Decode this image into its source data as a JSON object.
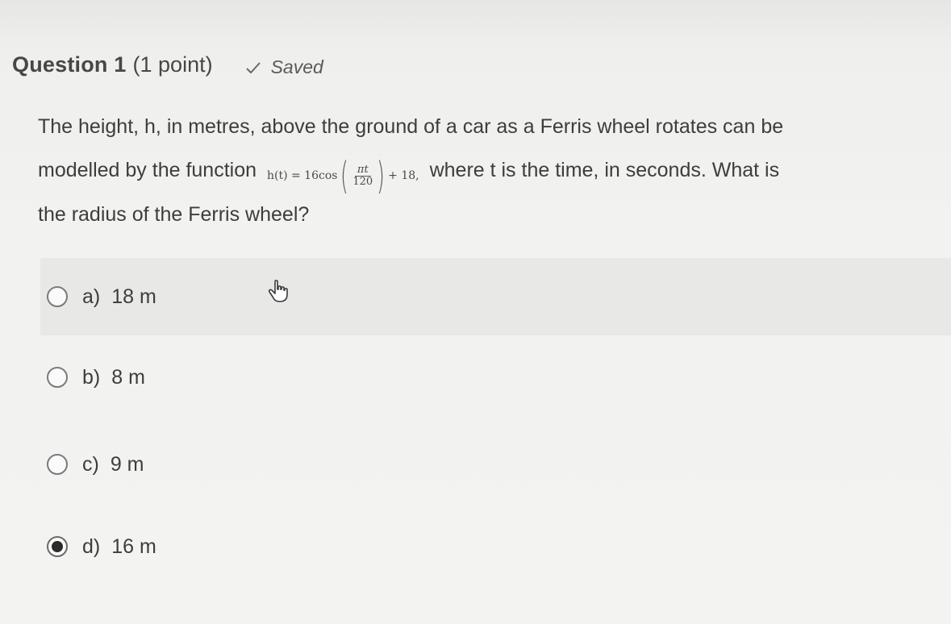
{
  "question": {
    "title": "Question 1",
    "points": "(1 point)",
    "status_icon": "check-icon",
    "status": "Saved",
    "text_line1": "The height, h, in metres, above the ground of a car as a Ferris wheel rotates can be",
    "text_line2_pre": "modelled by the function",
    "formula_lhs": "h(t) = 16cos",
    "formula_num": "πt",
    "formula_den": "120",
    "formula_rhs": "+ 18,",
    "text_line2_post": "where t is the time, in seconds. What is",
    "text_line3": "the radius of the Ferris wheel?"
  },
  "options": [
    {
      "letter": "a)",
      "value": "18 m",
      "selected": false
    },
    {
      "letter": "b)",
      "value": "8 m",
      "selected": false
    },
    {
      "letter": "c)",
      "value": "9 m",
      "selected": false
    },
    {
      "letter": "d)",
      "value": "16 m",
      "selected": true
    }
  ],
  "cursor_icon": "hand-pointer-icon"
}
